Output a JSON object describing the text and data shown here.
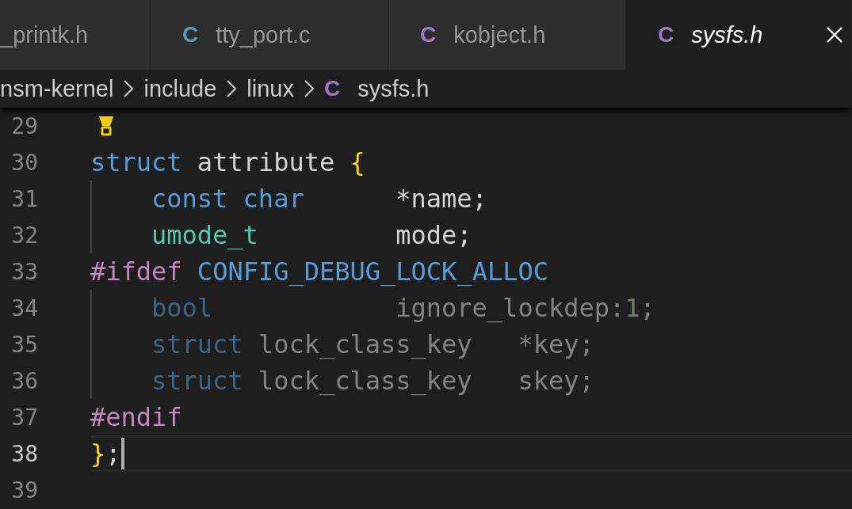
{
  "tabs": [
    {
      "label": "_printk.h",
      "selected": false,
      "preview": false
    },
    {
      "icon": "C",
      "color": "#519aba",
      "label": "tty_port.c",
      "selected": false,
      "preview": false
    },
    {
      "icon": "C",
      "color": "#a074c4",
      "label": "kobject.h",
      "selected": false,
      "preview": false
    },
    {
      "icon": "C",
      "color": "#a074c4",
      "label": "sysfs.h",
      "selected": true,
      "preview": true
    }
  ],
  "breadcrumb": [
    {
      "label": "nsm-kernel"
    },
    {
      "label": "include"
    },
    {
      "label": "linux"
    },
    {
      "icon": "C",
      "color": "#a074c4",
      "label": "sysfs.h"
    }
  ],
  "lines": [
    {
      "number": "29",
      "lightbulb": true
    },
    {
      "number": "30",
      "tokens": [
        {
          "kind": "keyword",
          "text": "struct"
        },
        {
          "kind": "plain",
          "text": " attribute "
        },
        {
          "kind": "bracket",
          "text": "{"
        }
      ]
    },
    {
      "number": "31",
      "indent": true,
      "tokens": [
        {
          "kind": "keyword",
          "text": "const char"
        },
        {
          "kind": "plain",
          "text": "      *name;"
        }
      ]
    },
    {
      "number": "32",
      "indent": true,
      "tokens": [
        {
          "kind": "type",
          "text": "umode_t"
        },
        {
          "kind": "plain",
          "text": "         mode;"
        }
      ]
    },
    {
      "number": "33",
      "tokens": [
        {
          "kind": "preproc",
          "text": "#ifdef"
        },
        {
          "kind": "macro",
          "text": " CONFIG_DEBUG_LOCK_ALLOC"
        }
      ]
    },
    {
      "number": "34",
      "indent": true,
      "inactive": true,
      "tokens": [
        {
          "kind": "keyword",
          "text": "bool"
        },
        {
          "kind": "plain",
          "text": "            ignore_lockdep:"
        },
        {
          "kind": "number",
          "text": "1"
        },
        {
          "kind": "plain",
          "text": ";"
        }
      ]
    },
    {
      "number": "35",
      "indent": true,
      "inactive": true,
      "tokens": [
        {
          "kind": "keyword",
          "text": "struct"
        },
        {
          "kind": "plain",
          "text": " lock_class_key   *key;"
        }
      ]
    },
    {
      "number": "36",
      "indent": true,
      "inactive": true,
      "tokens": [
        {
          "kind": "keyword",
          "text": "struct"
        },
        {
          "kind": "plain",
          "text": " lock_class_key   skey;"
        }
      ]
    },
    {
      "number": "37",
      "tokens": [
        {
          "kind": "preproc",
          "text": "#endif"
        }
      ]
    },
    {
      "number": "38",
      "active": true,
      "cursor": true,
      "tokens": [
        {
          "kind": "bracket",
          "text": "}"
        },
        {
          "kind": "plain",
          "text": ";"
        }
      ]
    },
    {
      "number": "39"
    }
  ]
}
